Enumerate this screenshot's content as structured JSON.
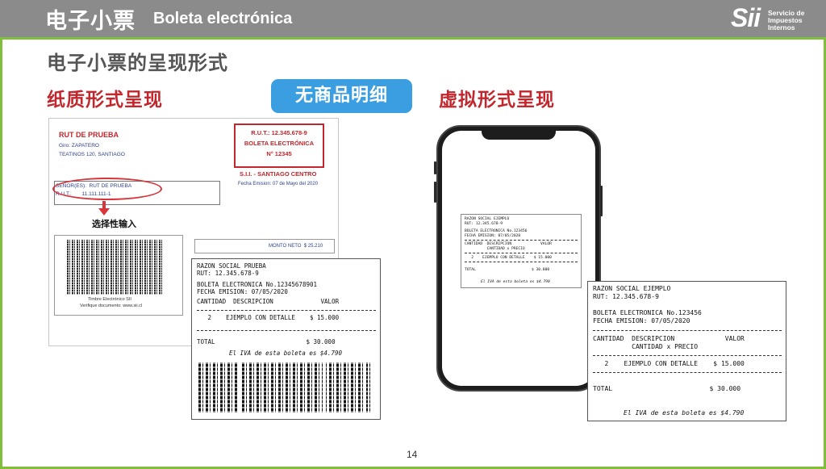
{
  "header": {
    "title_cn": "电子小票",
    "title_es": "Boleta electrónica",
    "logo_mark": "Sii",
    "logo_lines": [
      "Servicio de",
      "Impuestos",
      "Internos"
    ]
  },
  "slide": {
    "subtitle": "电子小票的呈现形式",
    "left_heading": "纸质形式呈现",
    "badge": "无商品明细",
    "right_heading": "虚拟形式呈现",
    "page_number": "14"
  },
  "paper_doc": {
    "rut_prueba": "RUT DE PRUEBA",
    "giro": "Giro: ZAPATERO",
    "address": "TEATINOS 120, SANTIAGO",
    "box_rut": "R.U.T.: 12.345.678-9",
    "box_type": "BOLETA ELECTRÓNICA",
    "box_number": "N° 12345",
    "sii_office": "S.I.I. - SANTIAGO CENTRO",
    "fecha_emision": "Fecha Emision: 07 de Mayo del 2020",
    "senores_label": "SEÑOR(ES):",
    "senores_value": "RUT DE PRUEBA",
    "rut_label": "R.U.T.:",
    "rut_value": "11.111.111-1",
    "optional_input": "选择性输入",
    "timbre": "Timbre Electrónico SII",
    "verifique": "Verifique documento: www.sii.cl",
    "monto_neto_label": "MONTO NETO",
    "monto_neto_value": "$    25.210"
  },
  "receipt_paper": {
    "lines": [
      "RAZON SOCIAL PRUEBA",
      "RUT: 12.345.678-9",
      "BOLETA ELECTRONICA No.12345678901",
      "FECHA EMISION: 07/05/2020",
      "CANTIDAD  DESCRIPCION             VALOR",
      "   2    EJEMPLO CON DETALLE    $ 15.000",
      "TOTAL                         $ 30.000",
      "El IVA de esta boleta es $4.790"
    ]
  },
  "receipt_virtual": {
    "lines": [
      "RAZON SOCIAL EJEMPLO",
      "RUT: 12.345.678-9",
      "BOLETA ELECTRONICA No.123456",
      "FECHA EMISION: 07/05/2020",
      "CANTIDAD  DESCRIPCION             VALOR",
      "          CANTIDAD x PRECIO",
      "   2    EJEMPLO CON DETALLE    $ 15.000",
      "TOTAL                         $ 30.000",
      "El IVA de esta boleta es $4.790"
    ]
  },
  "colors": {
    "topbar": "#8b8b8b",
    "accent_green": "#7fbf3b",
    "heading_red": "#c1272d",
    "badge_blue": "#3b9ee0"
  }
}
